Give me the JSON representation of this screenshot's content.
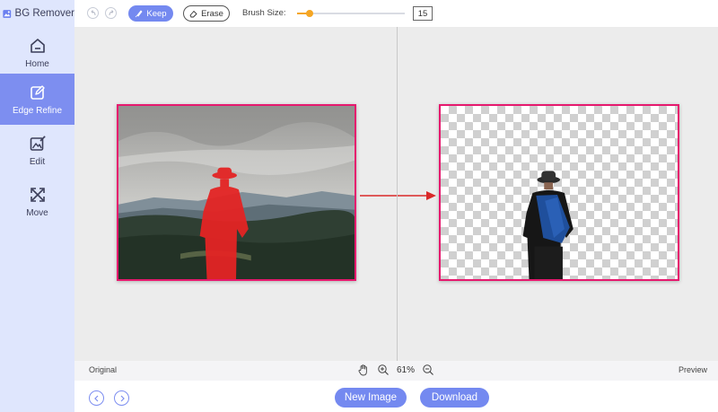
{
  "app": {
    "title": "BG Remover",
    "logo_icon": "image-icon"
  },
  "sidebar": {
    "items": [
      {
        "label": "Home",
        "icon": "home-icon",
        "active": false
      },
      {
        "label": "Edge Refine",
        "icon": "edit-square-icon",
        "active": true
      },
      {
        "label": "Edit",
        "icon": "image-edit-icon",
        "active": false
      },
      {
        "label": "Move",
        "icon": "move-icon",
        "active": false
      }
    ]
  },
  "toolbar": {
    "undo_icon": "undo-icon",
    "redo_icon": "redo-icon",
    "keep_label": "Keep",
    "erase_label": "Erase",
    "brush_label": "Brush Size:",
    "brush_value": "15",
    "brush_fraction": 0.12
  },
  "status": {
    "original_label": "Original",
    "preview_label": "Preview",
    "zoom": "61%"
  },
  "bottom": {
    "new_image_label": "New Image",
    "download_label": "Download"
  },
  "colors": {
    "accent": "#7489f0",
    "sidebar_bg": "#dfe6fd",
    "frame": "#e6196e",
    "arrow": "#d92a2a",
    "slider": "#f5a623"
  }
}
